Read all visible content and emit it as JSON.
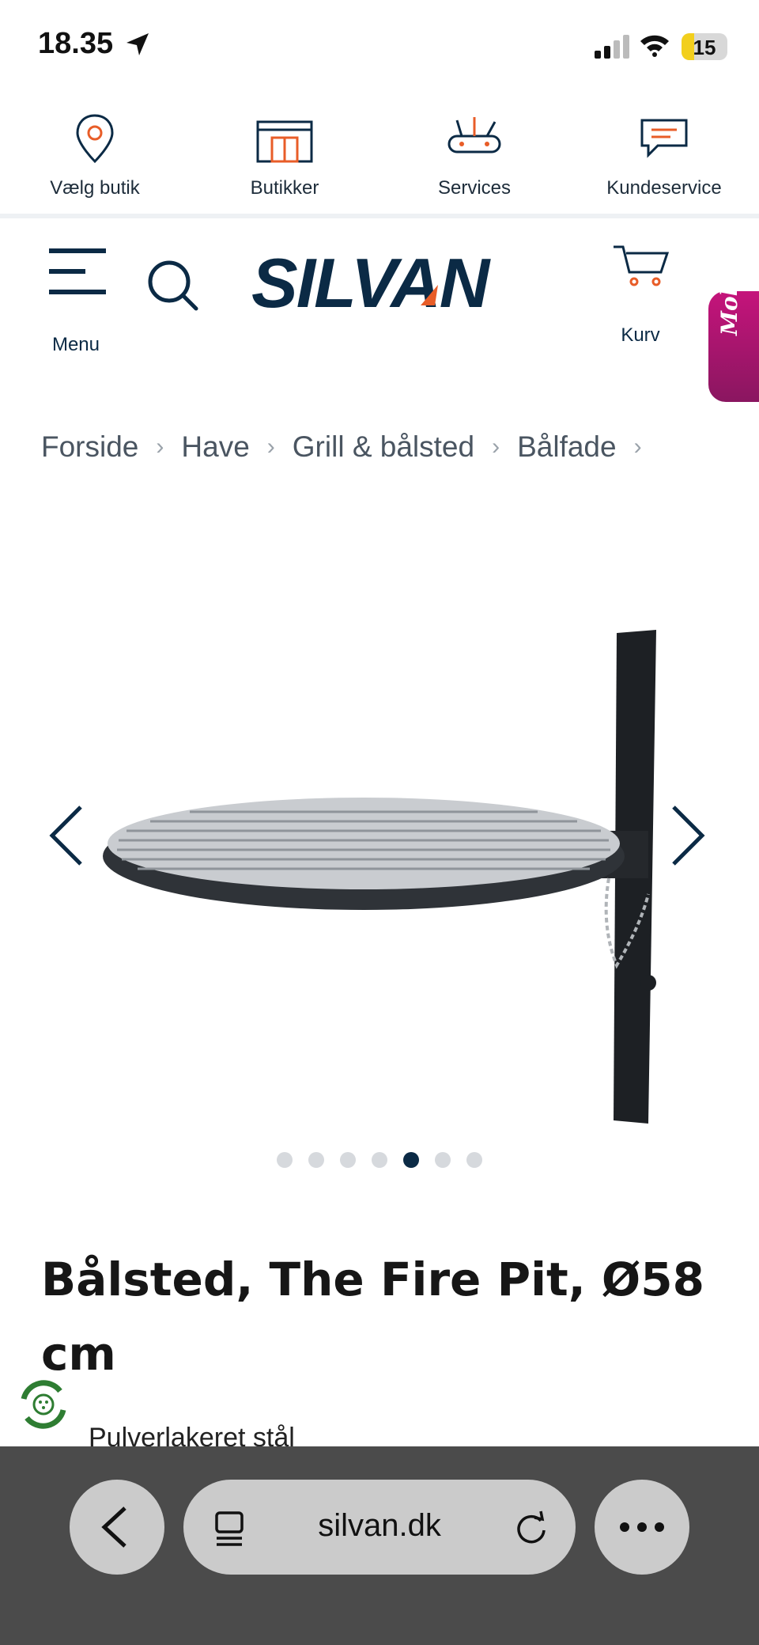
{
  "status_bar": {
    "time": "18.35",
    "battery": "15"
  },
  "utility_nav": [
    {
      "label": "Vælg butik",
      "icon": "location-pin-icon"
    },
    {
      "label": "Butikker",
      "icon": "store-icon"
    },
    {
      "label": "Services",
      "icon": "multitool-icon"
    },
    {
      "label": "Kundeservice",
      "icon": "chat-icon"
    }
  ],
  "header": {
    "menu_label": "Menu",
    "logo_text": "SILVAN",
    "cart_label": "Kurv",
    "molly_label": "Molly"
  },
  "breadcrumb": [
    "Forside",
    "Have",
    "Grill & bålsted",
    "Bålfade"
  ],
  "gallery": {
    "total_images": 7,
    "active_index": 4
  },
  "product": {
    "title": "Bålsted, The Fire Pit, Ø58 cm",
    "subtitle": "Pulverlakeret stål"
  },
  "browser": {
    "url": "silvan.dk"
  },
  "colors": {
    "brand_navy": "#0b2a45",
    "brand_orange": "#e85d28",
    "molly_magenta": "#c5147b"
  }
}
